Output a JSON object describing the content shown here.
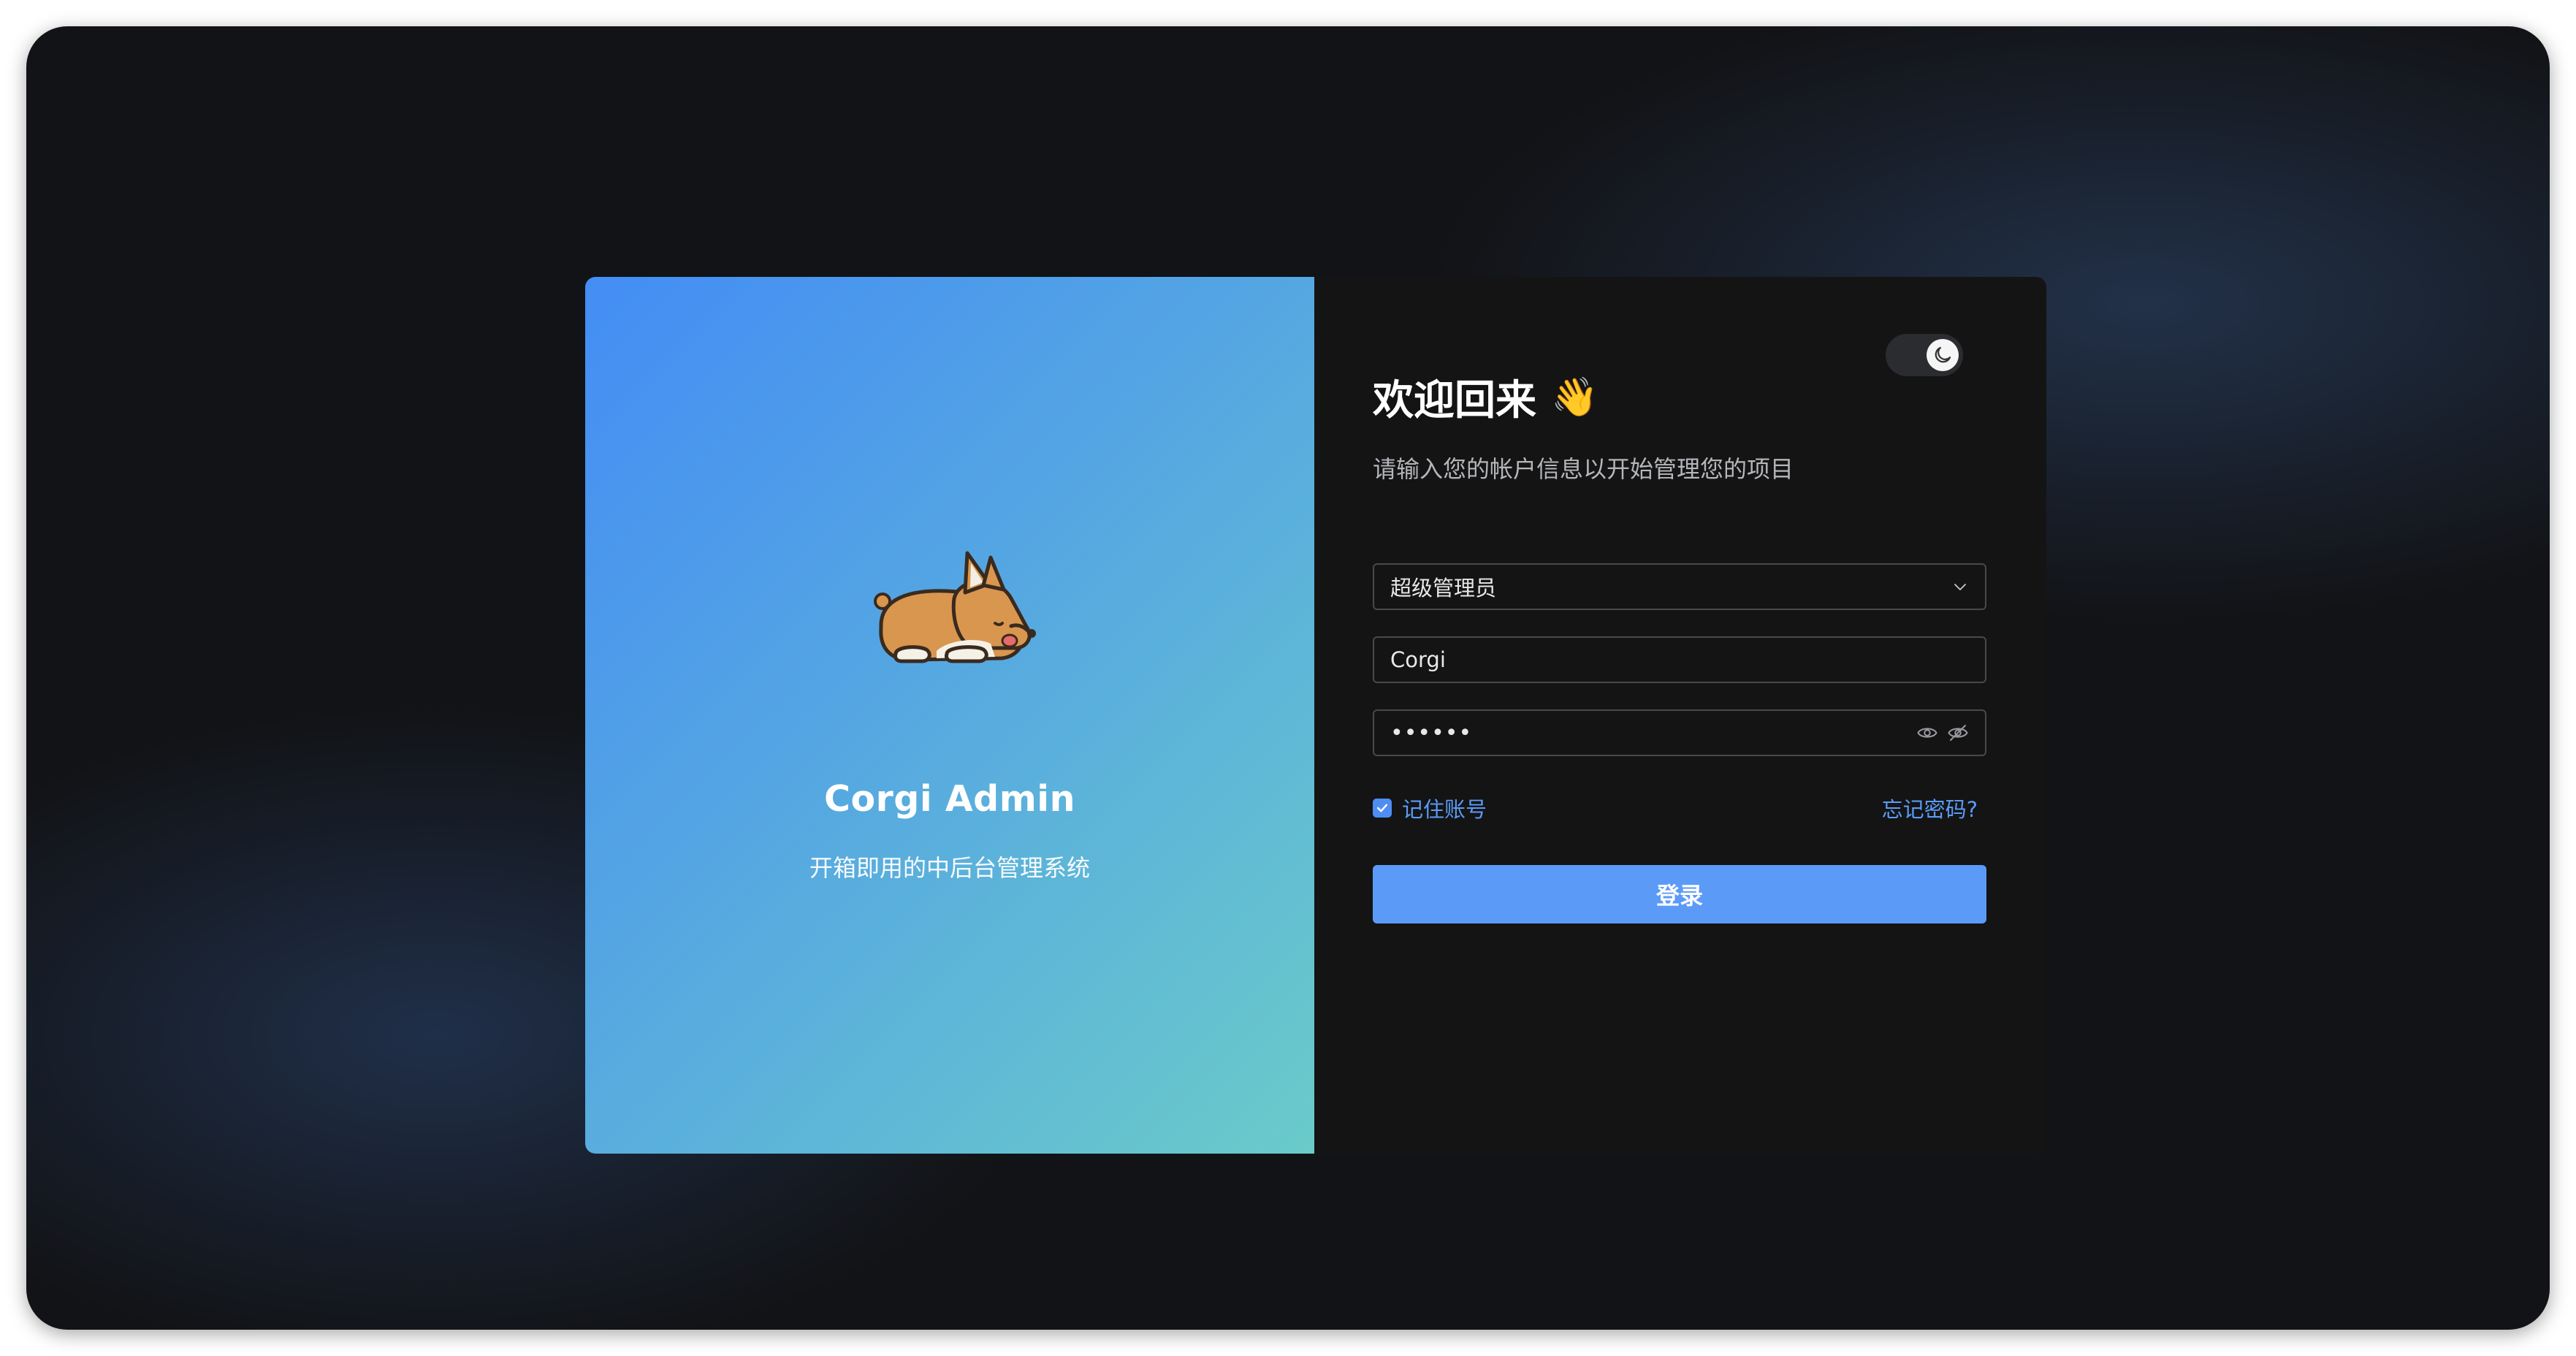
{
  "brand": {
    "title": "Corgi Admin",
    "subtitle": "开箱即用的中后台管理系统",
    "logo_icon": "corgi-logo-icon"
  },
  "theme_toggle": {
    "icon": "moon-icon",
    "state": "dark"
  },
  "login": {
    "welcome_title": "欢迎回来",
    "welcome_emoji": "👋",
    "welcome_subtitle": "请输入您的帐户信息以开始管理您的项目",
    "role_select": {
      "value": "超级管理员",
      "icon": "chevron-down-icon"
    },
    "username": {
      "value": "Corgi"
    },
    "password": {
      "value": "••••••",
      "icons": [
        "eye-icon",
        "eye-off-icon"
      ]
    },
    "remember": {
      "label": "记住账号",
      "checked": true
    },
    "forgot_label": "忘记密码?",
    "submit_label": "登录"
  },
  "colors": {
    "accent": "#5b9bf7",
    "panel_gradient_start": "#438df5",
    "panel_gradient_end": "#6acbc9",
    "form_background": "#141414"
  }
}
